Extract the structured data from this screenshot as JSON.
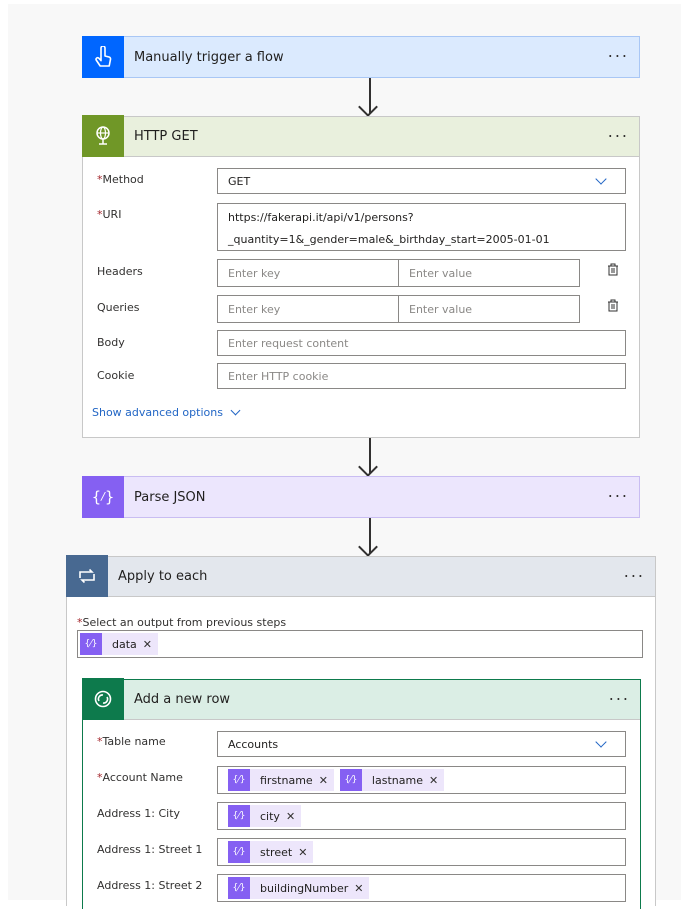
{
  "trigger": {
    "title": "Manually trigger a flow",
    "menu": "···"
  },
  "http": {
    "title": "HTTP GET",
    "menu": "···",
    "method_label": "Method",
    "method_value": "GET",
    "uri_label": "URI",
    "uri_line1": "https://fakerapi.it/api/v1/persons?",
    "uri_line2": "_quantity=1&_gender=male&_birthday_start=2005-01-01",
    "headers_label": "Headers",
    "queries_label": "Queries",
    "key_placeholder": "Enter key",
    "value_placeholder": "Enter value",
    "body_label": "Body",
    "body_placeholder": "Enter request content",
    "cookie_label": "Cookie",
    "cookie_placeholder": "Enter HTTP cookie",
    "advanced": "Show advanced options"
  },
  "parse": {
    "title": "Parse JSON",
    "menu": "···"
  },
  "apply": {
    "title": "Apply to each",
    "menu": "···",
    "select_label": "Select an output from previous steps",
    "token": "data"
  },
  "addrow": {
    "title": "Add a new row",
    "menu": "···",
    "table_label": "Table name",
    "table_value": "Accounts",
    "account_label": "Account Name",
    "account_tokens": [
      "firstname",
      "lastname"
    ],
    "city_label": "Address 1: City",
    "city_token": "city",
    "street1_label": "Address 1: Street 1",
    "street1_token": "street",
    "street2_label": "Address 1: Street 2",
    "street2_token": "buildingNumber"
  },
  "colors": {
    "trigger_accent": "#0066ff",
    "trigger_bg": "#dbeafe",
    "http_accent": "#709727",
    "http_bg": "#e9f0dd",
    "parse_accent": "#8560f2",
    "parse_bg": "#ece6fd",
    "apply_accent": "#486991",
    "apply_bg": "#e3e7ed",
    "dataverse_accent": "#0d7a4c",
    "dataverse_bg": "#dbeee5"
  },
  "icons": {
    "trigger": "hand-touch-icon",
    "http": "globe-icon",
    "parse": "braces-icon",
    "apply": "loop-icon",
    "dataverse": "dataverse-icon",
    "delete": "trash-icon"
  }
}
